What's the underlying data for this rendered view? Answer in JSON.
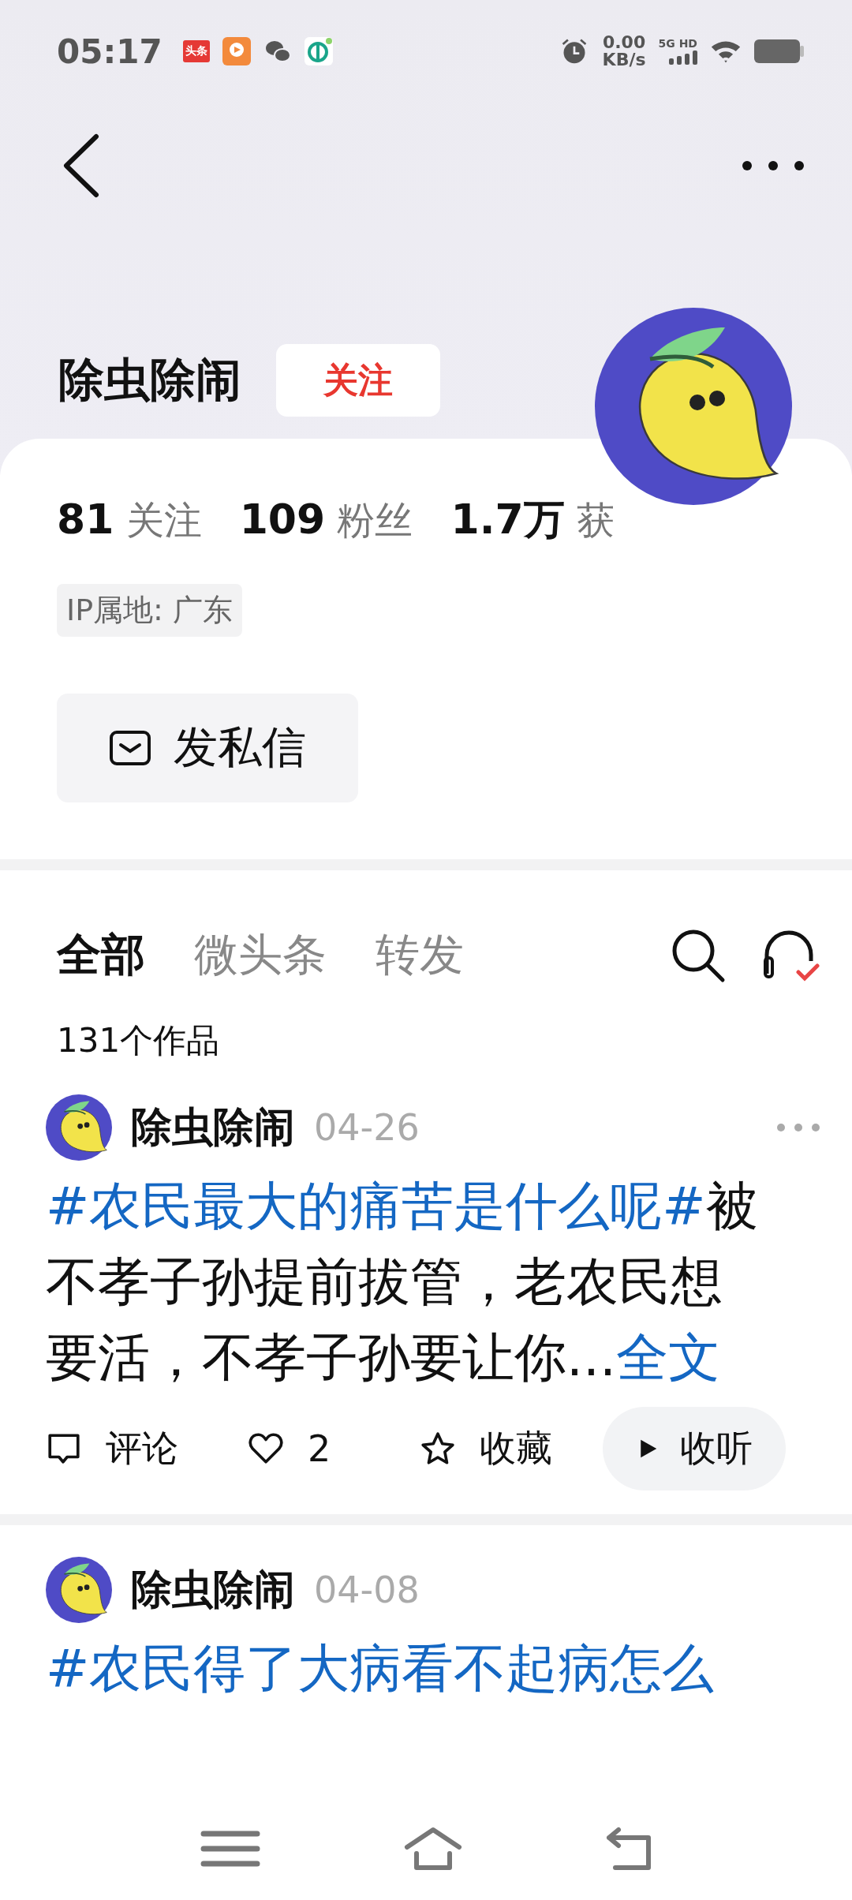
{
  "status_bar": {
    "time": "05:17",
    "app_badge": "头条",
    "speed_value": "0.00",
    "speed_unit": "KB/s",
    "network_label": "5G HD"
  },
  "profile": {
    "name": "除虫除闹",
    "follow_button": "关注",
    "stats": [
      "**81** 关注",
      "**109** 粉丝",
      "**1.7万** 获"
    ],
    "ip_location": "IP属地: 广东",
    "message_button": "发私信"
  },
  "tabs": [
    {
      "label": "全部",
      "selected": true
    },
    {
      "label": "微头条",
      "selected": false
    },
    {
      "label": "转发",
      "selected": false
    }
  ],
  "works_count": "131个作品",
  "posts": [
    {
      "author": "除虫除闹",
      "date": "04-26",
      "hashtag": "#农民最大的痛苦是什么呢#",
      "text": "被不孝子孙提前拔管，老农民想要活，不孝子孙要让你...",
      "more_link": "全文",
      "actions": [
        {
          "kind": "comment",
          "label": "评论"
        },
        {
          "kind": "like",
          "label": "2"
        },
        {
          "kind": "favorite",
          "label": "收藏"
        },
        {
          "kind": "listen",
          "label": "收听"
        }
      ]
    },
    {
      "author": "除虫除闹",
      "date": "04-08",
      "hashtag": "#农民得了大病看不起病怎么"
    }
  ]
}
